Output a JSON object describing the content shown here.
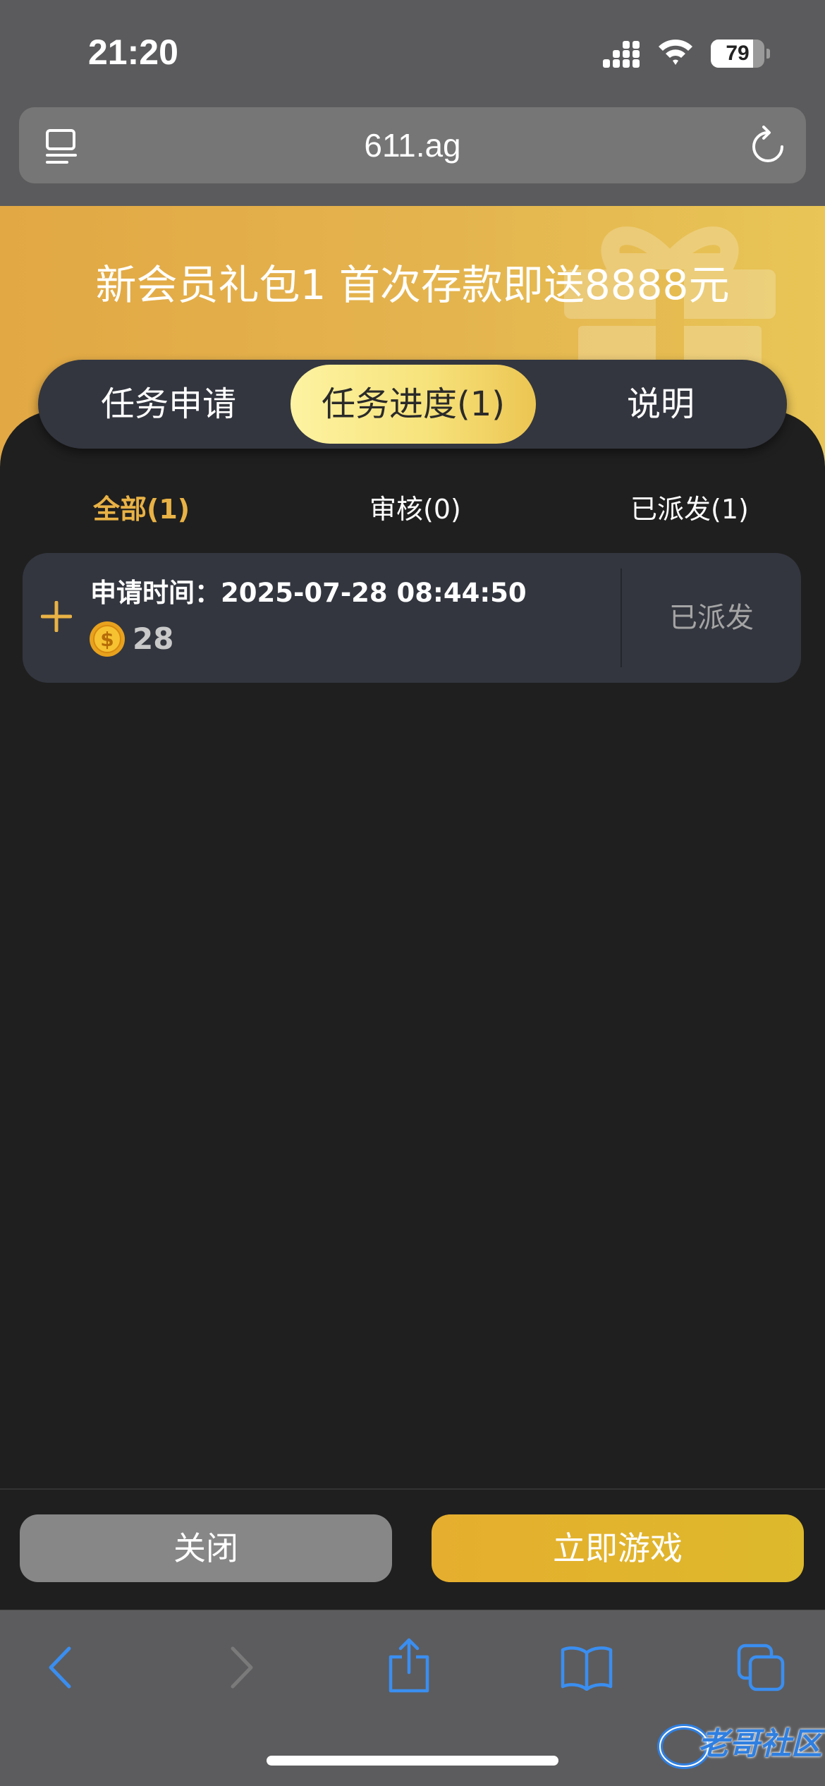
{
  "status_bar": {
    "time": "21:20",
    "battery": "79",
    "battery_level_percent": 79
  },
  "browser": {
    "url": "611.ag"
  },
  "banner": {
    "title": "新会员礼包1 首次存款即送8888元"
  },
  "tabs": [
    {
      "label": "任务申请",
      "active": false
    },
    {
      "label": "任务进度(1)",
      "active": true
    },
    {
      "label": "说明",
      "active": false
    }
  ],
  "filters": [
    {
      "label": "全部(1)",
      "active": true
    },
    {
      "label": "审核(0)",
      "active": false
    },
    {
      "label": "已派发(1)",
      "active": false
    }
  ],
  "records": [
    {
      "time": "申请时间：2025-07-28 08:44:50",
      "amount": "28",
      "status": "已派发"
    }
  ],
  "buttons": {
    "close": "关闭",
    "play": "立即游戏"
  },
  "watermark": {
    "text": "老哥社区"
  },
  "colors": {
    "accent": "#e9b245",
    "tab_active": "#f7e37c",
    "play_button": "#e2b22e",
    "link_blue": "#3a8ef0"
  }
}
